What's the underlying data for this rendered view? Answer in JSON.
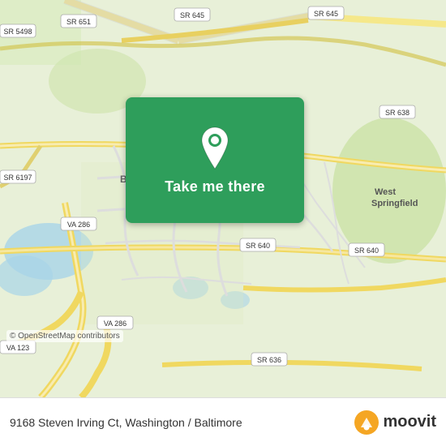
{
  "map": {
    "copyright": "© OpenStreetMap contributors",
    "alt": "Map of Burke, Virginia area"
  },
  "card": {
    "button_label": "Take me there",
    "pin_color": "#ffffff"
  },
  "bottom_bar": {
    "address": "9168 Steven Irving Ct, Washington / Baltimore",
    "logo_text": "moovit"
  }
}
